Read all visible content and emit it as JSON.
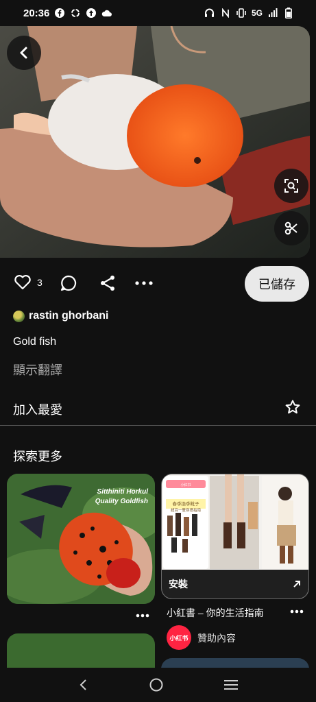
{
  "status_bar": {
    "time": "20:36",
    "network": "5G",
    "icons": [
      "facebook-icon",
      "sync-icon",
      "upload-icon",
      "cloud-icon",
      "headphones-icon",
      "nfc-icon",
      "vibrate-icon",
      "signal-icon",
      "battery-icon"
    ]
  },
  "pin": {
    "like_count": "3",
    "saved_label": "已儲存",
    "author": "rastin ghorbani",
    "title": "Gold fish",
    "translate_label": "顯示翻譯",
    "favorite_label": "加入最愛"
  },
  "explore": {
    "heading": "探索更多",
    "fish_card": {
      "caption_line1": "Sitthiniti Horkul",
      "caption_line2": "Quality Goldfish"
    },
    "ad_card": {
      "install_label": "安裝",
      "title": "小紅書 – 你的生活指南",
      "logo_text": "小红书",
      "sponsored_label": "贊助內容",
      "banner_line1": "春季換季靴子",
      "banner_line2": "超百一雙穿搭指南"
    }
  },
  "colors": {
    "background": "#111111",
    "saved_button": "#e9e9e9",
    "ad_brand": "#ff2442"
  }
}
